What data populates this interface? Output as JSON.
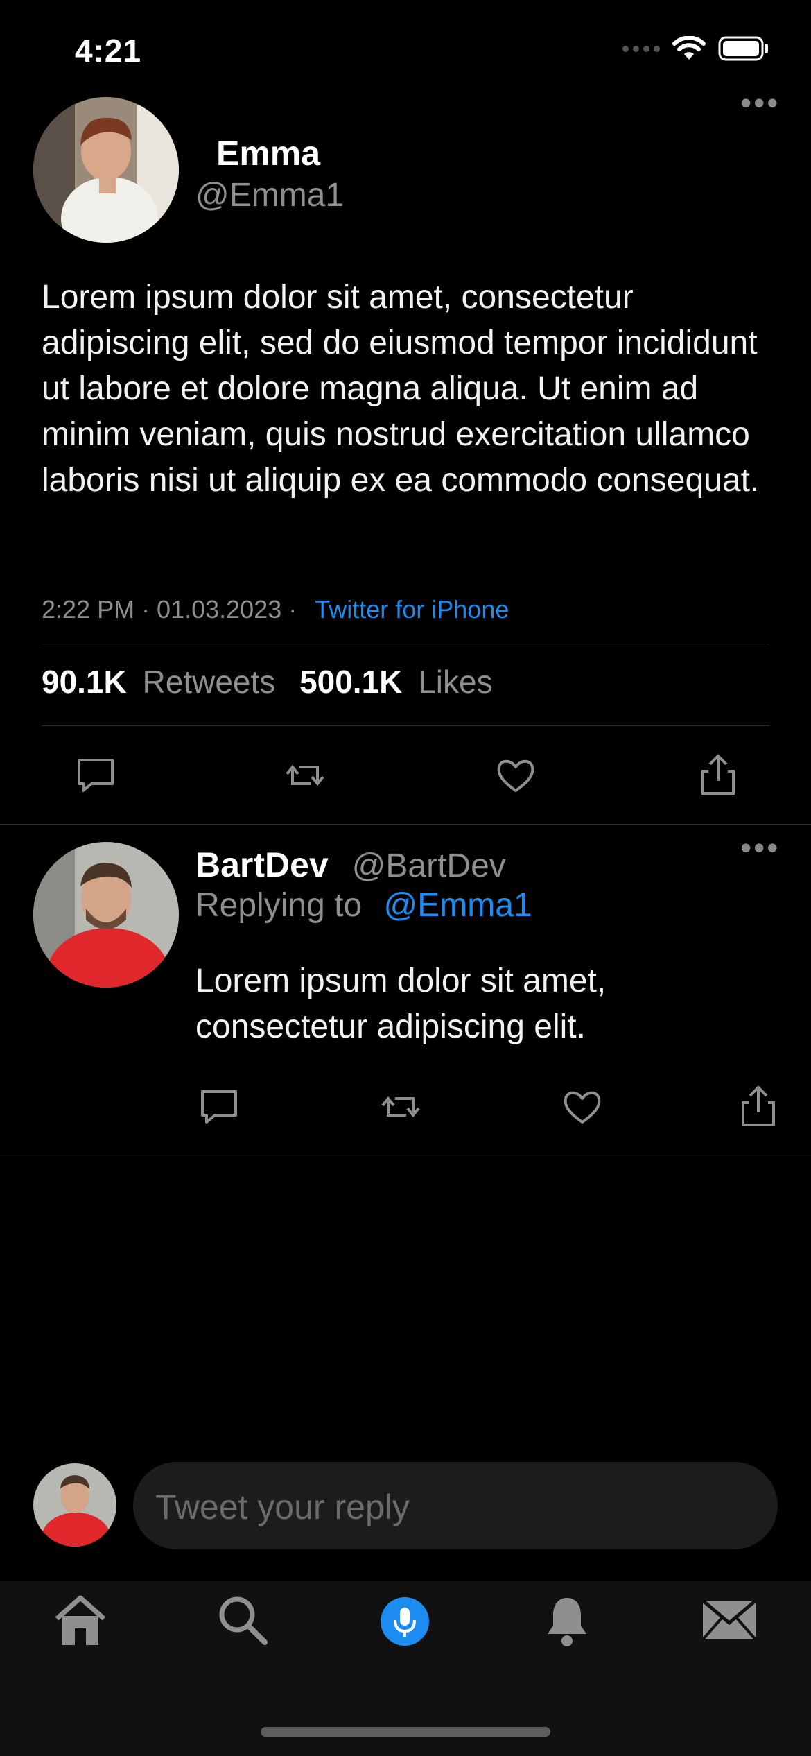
{
  "status_bar": {
    "time": "4:21"
  },
  "main_tweet": {
    "name": "Emma",
    "handle": "@Emma1",
    "text": "Lorem ipsum dolor sit amet, consectetur adipiscing elit, sed do eiusmod tempor incididunt ut labore et dolore magna aliqua. Ut enim ad minim veniam, quis nostrud exercitation ullamco laboris nisi ut aliquip ex ea commodo consequat.",
    "timestamp": "2:22 PM · 01.03.2023 ·",
    "source": "Twitter for iPhone",
    "retweets_count": "90.1K",
    "retweets_label": "Retweets",
    "likes_count": "500.1K",
    "likes_label": "Likes",
    "more_label": "•••"
  },
  "reply": {
    "name": "BartDev",
    "handle": "@BartDev",
    "replying_to_label": "Replying to",
    "replying_to_handle": "@Emma1",
    "text": "Lorem ipsum dolor sit amet, consectetur adipiscing elit.",
    "more_label": "•••"
  },
  "composer": {
    "placeholder": "Tweet your reply"
  },
  "tabbar": {
    "items": [
      "home-icon",
      "search-icon",
      "spaces-mic-icon",
      "notifications-bell-icon",
      "messages-envelope-icon"
    ],
    "active_color": "#1d8cf0"
  },
  "colors": {
    "accent": "#1d8cf0",
    "muted": "#8f8f8f"
  }
}
